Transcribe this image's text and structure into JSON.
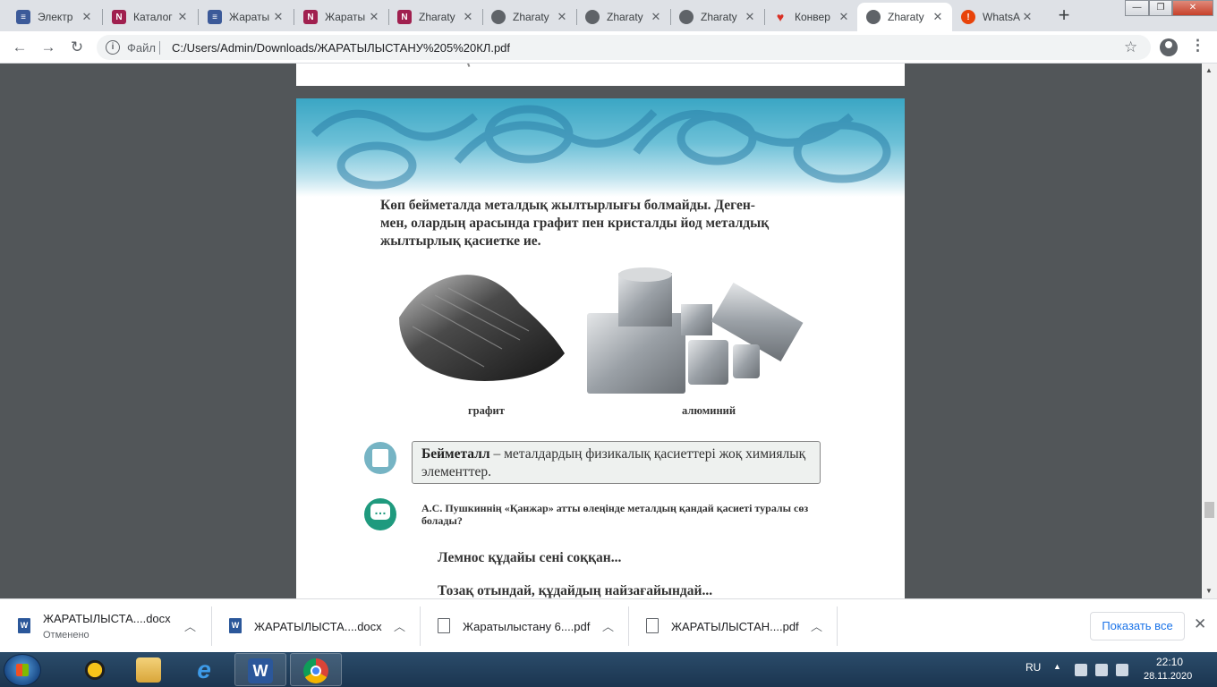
{
  "tabs": [
    {
      "title": "Электр",
      "favicon": "book-icon",
      "color": "#3c5a99"
    },
    {
      "title": "Каталог",
      "favicon": "library-icon",
      "color": "#a0204f"
    },
    {
      "title": "Жараты",
      "favicon": "book-icon",
      "color": "#3c5a99"
    },
    {
      "title": "Жараты",
      "favicon": "library-icon",
      "color": "#a0204f"
    },
    {
      "title": "Zharaty",
      "favicon": "library-icon",
      "color": "#a0204f"
    },
    {
      "title": "Zharaty",
      "favicon": "globe-icon",
      "color": "#5f6368"
    },
    {
      "title": "Zharaty",
      "favicon": "globe-icon",
      "color": "#5f6368"
    },
    {
      "title": "Zharaty",
      "favicon": "globe-icon",
      "color": "#5f6368"
    },
    {
      "title": "Конвер",
      "favicon": "heart-icon",
      "color": "#d93025"
    },
    {
      "title": "Zharaty",
      "favicon": "globe-icon",
      "color": "#5f6368"
    },
    {
      "title": "WhatsA",
      "favicon": "alert-icon",
      "color": "#e8430a"
    }
  ],
  "active_tab_index": 9,
  "address": {
    "scheme_label": "Файл",
    "url": "C:/Users/Admin/Downloads/ЖАРАТЫЛЫСТАНУ%205%20КЛ.pdf"
  },
  "document": {
    "paragraph": [
      "Көп бейметалда металдық жылтырлығы болмайды. Деген-",
      "мен, олардың арасында графит пен кристалды йод  металдық",
      "жылтырлық қасиетке ие."
    ],
    "caption_left": "графит",
    "caption_right": "алюминий",
    "definition_term": "Бейметалл",
    "definition_text": " – металдардың  физикалық қасиеттері жоқ химиялық элементтер.",
    "question": "А.С. Пушкиннің «Қанжар» атты өлеңінде металдың қандай қасиеті туралы сөз болады?",
    "poem_line_1": "Лемнос құдайы сені соққан...",
    "poem_line_2": "Тозақ отындай, құдайдың найзағайындай..."
  },
  "downloads": [
    {
      "name": "ЖАРАТЫЛЫСТА....docx",
      "status": "Отменено",
      "icon": "word-icon"
    },
    {
      "name": "ЖАРАТЫЛЫСТА....docx",
      "status": "",
      "icon": "word-icon"
    },
    {
      "name": "Жаратылыстану 6....pdf",
      "status": "",
      "icon": "file-icon"
    },
    {
      "name": "ЖАРАТЫЛЫСТАН....pdf",
      "status": "",
      "icon": "file-icon"
    }
  ],
  "show_all_label": "Показать все",
  "taskbar": {
    "lang": "RU",
    "time": "22:10",
    "date": "28.11.2020"
  }
}
